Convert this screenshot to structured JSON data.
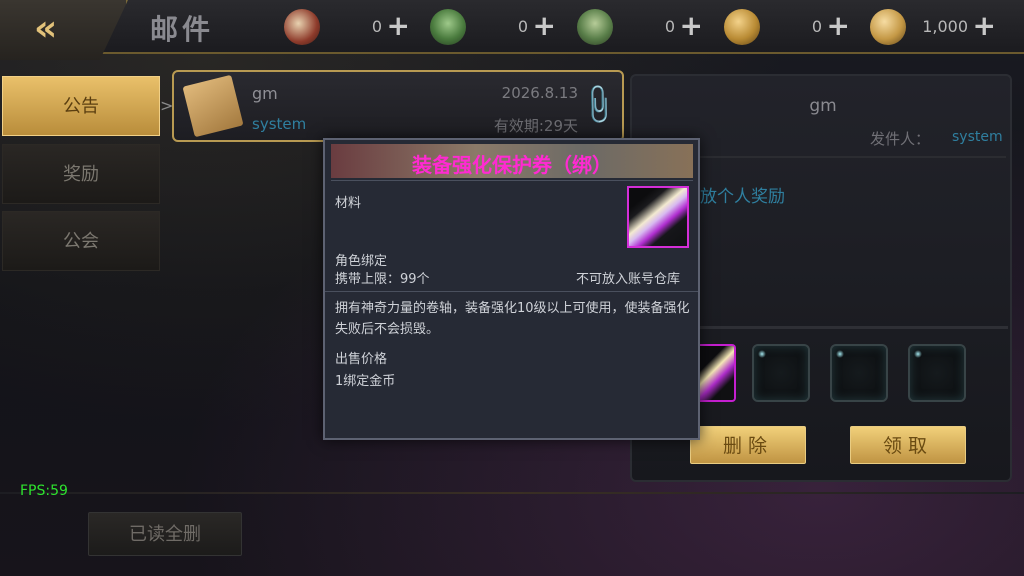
{
  "header": {
    "back_label": "«",
    "title": "邮件",
    "currencies": [
      {
        "icon": "scroll-icon",
        "value": "0",
        "plus": "+"
      },
      {
        "icon": "map-icon",
        "value": "0",
        "plus": "+"
      },
      {
        "icon": "map2-icon",
        "value": "0",
        "plus": "+"
      },
      {
        "icon": "coin-icon",
        "value": "0",
        "plus": "+"
      },
      {
        "icon": "coin2-icon",
        "value": "1,000",
        "plus": "+"
      }
    ]
  },
  "tabs": [
    {
      "label": "公告",
      "active": true
    },
    {
      "label": "奖励",
      "active": false
    },
    {
      "label": "公会",
      "active": false
    }
  ],
  "tab_arrow": ">",
  "mail_list": [
    {
      "sender": "gm",
      "sub": "system",
      "date": "2026.8.13",
      "expiry": "有效期:29天"
    }
  ],
  "detail": {
    "sender": "gm",
    "from_label": "发件人：",
    "from_value": "system",
    "body": "放个人奖励",
    "delete_label": "删除",
    "claim_label": "领取"
  },
  "bottom": {
    "fps": "FPS:59",
    "delete_read_label": "已读全删"
  },
  "tooltip": {
    "title": "装备强化保护券（绑）",
    "category": "材料",
    "bind": "角色绑定",
    "carry_limit": "携带上限：99个",
    "storage": "不可放入账号仓库",
    "description": "拥有神奇力量的卷轴，装备强化10级以上可使用，使装备强化失败后不会损毁。",
    "price_label": "出售价格",
    "price_value": "1绑定金币"
  },
  "colors": {
    "accent_gold": "#e9c06a",
    "tooltip_title": "#ff2ad2",
    "link_blue": "#2f7f9f",
    "fps_green": "#2ee32e"
  }
}
